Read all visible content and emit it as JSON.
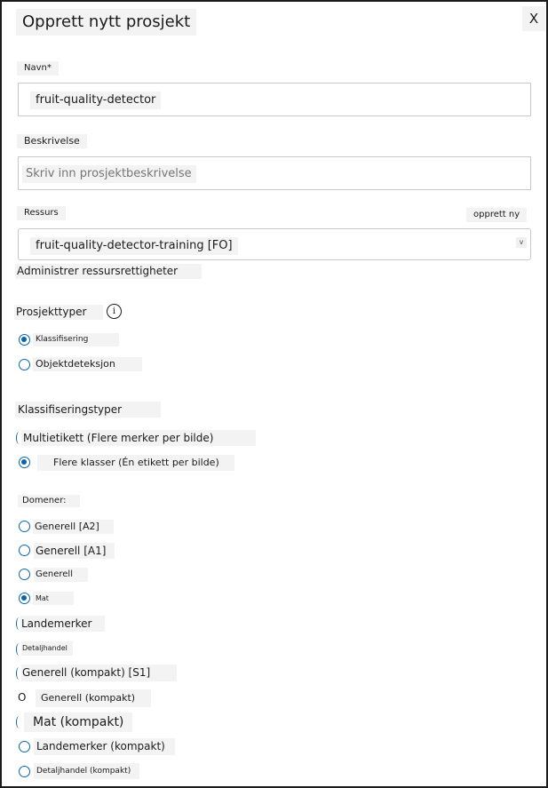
{
  "dialog": {
    "title": "Opprett nytt prosjekt",
    "close_label": "X"
  },
  "name": {
    "label": "Navn*",
    "value": "fruit-quality-detector"
  },
  "description": {
    "label": "Beskrivelse",
    "placeholder": "Skriv inn prosjektbeskrivelse"
  },
  "resource": {
    "label": "Ressurs",
    "create_new": "opprett ny",
    "selected": "fruit-quality-detector-training [FO]",
    "chevron": "v",
    "manage_link": "Administrer ressursrettigheter"
  },
  "project_types": {
    "label": "Prosjekttyper",
    "info_icon": "i",
    "options": [
      {
        "label": "Klassifisering",
        "selected": true
      },
      {
        "label": "Objektdeteksjon",
        "selected": false
      }
    ]
  },
  "classification_types": {
    "label": "Klassifiseringstyper",
    "options": [
      {
        "label": "Multietikett (Flere merker per bilde)",
        "selected": false
      },
      {
        "label": "Flere klasser (Én etikett per bilde)",
        "selected": true
      }
    ]
  },
  "domains": {
    "label": "Domener:",
    "options": [
      {
        "label": "Generell [A2]",
        "selected": false
      },
      {
        "label": "Generell [A1]",
        "selected": false
      },
      {
        "label": "Generell",
        "selected": false
      },
      {
        "label": "Mat",
        "selected": true
      },
      {
        "label": "Landemerker",
        "selected": false
      },
      {
        "label": "Detaljhandel",
        "selected": false
      },
      {
        "label": "Generell (kompakt) [S1]",
        "selected": false
      },
      {
        "label": "Generell (kompakt)",
        "selected": false
      },
      {
        "label": "Mat (kompakt)",
        "selected": false
      },
      {
        "label": "Landemerker (kompakt)",
        "selected": false
      },
      {
        "label": "Detaljhandel (kompakt)",
        "selected": false
      }
    ]
  }
}
